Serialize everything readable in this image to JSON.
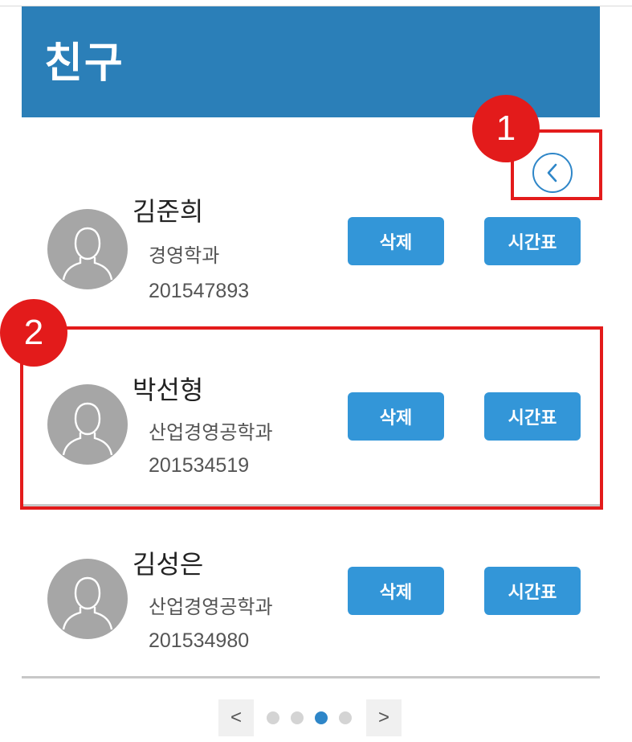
{
  "header": {
    "title": "친구"
  },
  "back_button": {
    "icon": "chevron-left-icon"
  },
  "friends": [
    {
      "name": "김준희",
      "department": "경영학과",
      "student_id": "201547893",
      "delete_label": "삭제",
      "timetable_label": "시간표"
    },
    {
      "name": "박선형",
      "department": "산업경영공학과",
      "student_id": "201534519",
      "delete_label": "삭제",
      "timetable_label": "시간표"
    },
    {
      "name": "김성은",
      "department": "산업경영공학과",
      "student_id": "201534980",
      "delete_label": "삭제",
      "timetable_label": "시간표"
    }
  ],
  "annotations": [
    {
      "number": "1"
    },
    {
      "number": "2"
    }
  ],
  "pagination": {
    "prev": "<",
    "next": ">",
    "total_pages": 4,
    "current_page": 3
  },
  "colors": {
    "header": "#2b7fb8",
    "button": "#3396d8",
    "annotation": "#e31b1b",
    "avatar": "#a6a6a6"
  }
}
